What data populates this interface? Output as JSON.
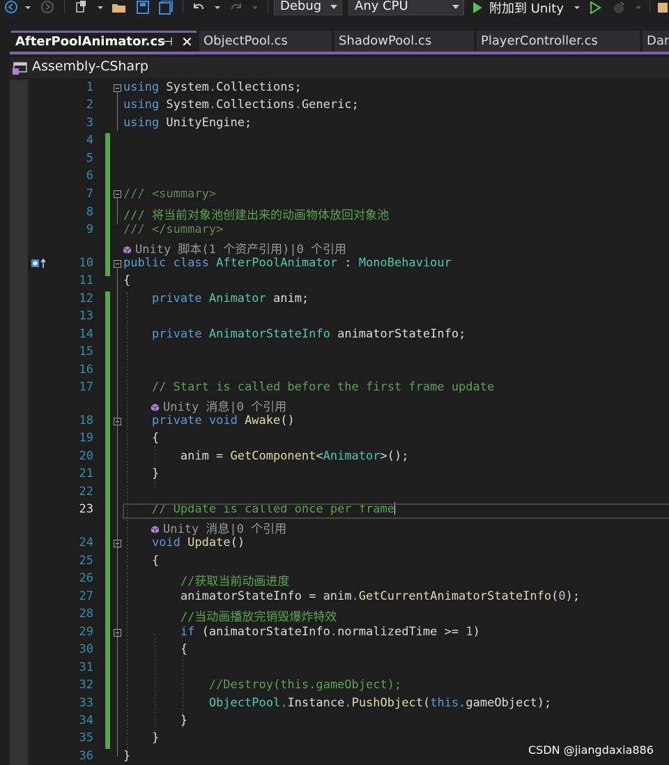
{
  "toolbar": {
    "config": "Debug",
    "platform": "Any CPU",
    "attach_label": "附加到 Unity",
    "icons": [
      "back-icon",
      "forward-icon",
      "new-item-icon",
      "open-file-icon",
      "save-icon",
      "save-all-icon",
      "undo-icon",
      "redo-icon",
      "start-icon",
      "run-without-debug-icon",
      "hot-reload-icon"
    ]
  },
  "tabs": [
    {
      "label": "AfterPoolAnimator.cs",
      "active": true
    },
    {
      "label": "ObjectPool.cs"
    },
    {
      "label": "ShadowPool.cs"
    },
    {
      "label": "PlayerController.cs"
    },
    {
      "label": "Dan"
    }
  ],
  "navbar": {
    "project": "Assembly-CSharp"
  },
  "editor": {
    "current_line": 23,
    "lines": [
      {
        "n": "1",
        "html": "<span class='kw'>using</span> System<span class='dim'>.</span>Collections;"
      },
      {
        "n": "2",
        "html": "<span class='kw'>using</span> System<span class='dim'>.</span>Collections<span class='dim'>.</span>Generic;"
      },
      {
        "n": "3",
        "html": "<span class='kw'>using</span> UnityEngine;"
      },
      {
        "n": "4",
        "html": ""
      },
      {
        "n": "5",
        "html": ""
      },
      {
        "n": "6",
        "html": ""
      },
      {
        "n": "7",
        "html": "<span class='xml'>/// &lt;summary&gt;</span>"
      },
      {
        "n": "8",
        "html": "<span class='cm'>/// 将当前对象池创建出来的动画物体放回对象池</span>"
      },
      {
        "n": "9",
        "html": "<span class='xml'>/// &lt;/summary&gt;</span>"
      },
      {
        "n": "10",
        "html": "<span class='kw'>public</span> <span class='kw'>class</span> <span class='ty'>AfterPoolAnimator</span> : <span class='ty'>MonoBehaviour</span>"
      },
      {
        "n": "11",
        "html": "{"
      },
      {
        "n": "12",
        "html": "    <span class='kw'>private</span> <span class='ty'>Animator</span> anim;"
      },
      {
        "n": "13",
        "html": ""
      },
      {
        "n": "14",
        "html": "    <span class='kw'>private</span> <span class='ty'>AnimatorStateInfo</span> animatorStateInfo;"
      },
      {
        "n": "15",
        "html": ""
      },
      {
        "n": "16",
        "html": ""
      },
      {
        "n": "17",
        "html": "    <span class='cm'>// Start is called before the first frame update</span>"
      },
      {
        "n": "18",
        "html": "    <span class='kw'>private</span> <span class='kw'>void</span> <span class='mt'>Awake</span>()"
      },
      {
        "n": "19",
        "html": "    {"
      },
      {
        "n": "20",
        "html": "        anim = <span class='mt'>GetComponent</span>&lt;<span class='ty'>Animator</span>&gt;();"
      },
      {
        "n": "21",
        "html": "    }"
      },
      {
        "n": "22",
        "html": ""
      },
      {
        "n": "23",
        "html": "    <span class='cm'>// Update is called once per frame</span><span class='caret'></span>"
      },
      {
        "n": "24",
        "html": "    <span class='kw'>void</span> <span class='mt'>Update</span>()"
      },
      {
        "n": "25",
        "html": "    {"
      },
      {
        "n": "26",
        "html": "        <span class='cm'>//获取当前动画进度</span>"
      },
      {
        "n": "27",
        "html": "        animatorStateInfo = anim<span class='dim'>.</span><span class='mt'>GetCurrentAnimatorStateInfo</span>(<span class='num'>0</span>);"
      },
      {
        "n": "28",
        "html": "        <span class='cm'>//当动画播放完销毁爆炸特效</span>"
      },
      {
        "n": "29",
        "html": "        <span class='kw'>if</span> (animatorStateInfo<span class='dim'>.</span>normalizedTime &gt;= <span class='num'>1</span>)"
      },
      {
        "n": "30",
        "html": "        {"
      },
      {
        "n": "31",
        "html": ""
      },
      {
        "n": "32",
        "html": "            <span class='cm'>//Destroy(this.gameObject);</span>"
      },
      {
        "n": "33",
        "html": "            <span class='ty'>ObjectPool</span><span class='dim'>.</span>Instance<span class='dim'>.</span><span class='mt'>PushObject</span>(<span class='kw'>this</span><span class='dim'>.</span>gameObject);"
      },
      {
        "n": "34",
        "html": "        }"
      },
      {
        "n": "35",
        "html": "    }"
      },
      {
        "n": "36",
        "html": "}"
      }
    ],
    "codelens": [
      {
        "text": "Unity 脚本(1 个资产引用)|0 个引用"
      },
      {
        "text": "Unity 消息|0 个引用"
      },
      {
        "text": "Unity 消息|0 个引用"
      }
    ]
  },
  "watermark": "CSDN @jiangdaxia886"
}
